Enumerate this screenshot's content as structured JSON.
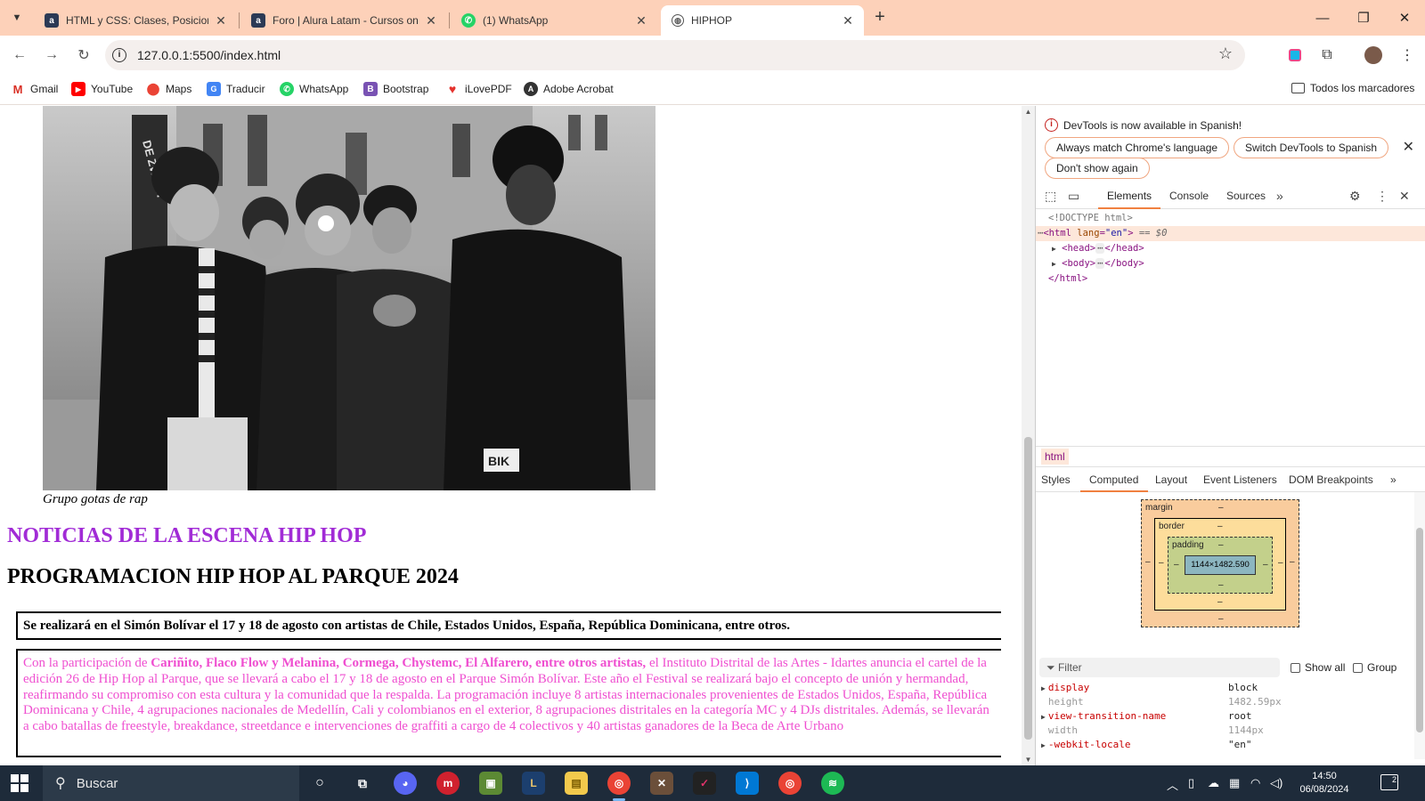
{
  "browser": {
    "tabs": [
      {
        "title": "HTML y CSS: Clases, Posicionamiento",
        "icon": "alura-icon",
        "active": false
      },
      {
        "title": "Foro | Alura Latam - Cursos online",
        "icon": "alura-icon",
        "active": false
      },
      {
        "title": "(1) WhatsApp",
        "icon": "whatsapp-icon",
        "active": false
      },
      {
        "title": "HIPHOP",
        "icon": "globe-icon",
        "active": true
      }
    ],
    "url": "127.0.0.1:5500/index.html",
    "bookmarks": [
      {
        "label": "Gmail",
        "icon": "gmail-icon",
        "color": "#d93025"
      },
      {
        "label": "YouTube",
        "icon": "youtube-icon",
        "color": "#ff0000"
      },
      {
        "label": "Maps",
        "icon": "maps-icon",
        "color": "#34a853"
      },
      {
        "label": "Traducir",
        "icon": "translate-icon",
        "color": "#4285f4"
      },
      {
        "label": "WhatsApp",
        "icon": "whatsapp-icon",
        "color": "#25d366"
      },
      {
        "label": "Bootstrap",
        "icon": "bootstrap-icon",
        "color": "#7952b3"
      },
      {
        "label": "iLovePDF",
        "icon": "ilovepdf-icon",
        "color": "#e5322d"
      },
      {
        "label": "Adobe Acrobat",
        "icon": "acrobat-icon",
        "color": "#333333"
      }
    ],
    "all_bookmarks": "Todos los marcadores"
  },
  "page": {
    "caption": "Grupo gotas de rap",
    "news_title": "NOTICIAS DE LA ESCENA HIP HOP",
    "prog_title": "PROGRAMACION HIP HOP AL PARQUE 2024",
    "summary": "Se realizará en el Simón Bolívar el 17 y 18 de agosto con artistas de Chile, Estados Unidos, España, República Dominicana, entre otros.",
    "article_intro": "Con la participación de ",
    "article_artists": "Cariñito, Flaco Flow y Melanina, Cormega, Chystemc, El Alfarero, entre otros artistas,",
    "article_body": " el Instituto Distrital de las Artes - Idartes anuncia el cartel de la edición 26 de Hip Hop al Parque, que se llevará a cabo el 17 y 18 de agosto en el Parque Simón Bolívar. Este año el Festival se realizará bajo el concepto de unión y hermandad, reafirmando su compromiso con esta cultura y la comunidad que la respalda. La programación incluye 8 artistas internacionales provenientes de Estados Unidos, España, República Dominicana y Chile, 4 agrupaciones nacionales de Medellín, Cali y colombianos en el exterior, 8 agrupaciones distritales en la categoría MC y 4 DJs distritales. Además, se llevarán a cabo batallas de freestyle, breakdance, streetdance e intervenciones de graffiti a cargo de 4 colectivos y 40 artistas ganadores de la Beca de Arte Urbano"
  },
  "devtools": {
    "notice": "DevTools is now available in Spanish!",
    "btn_match": "Always match Chrome's language",
    "btn_switch": "Switch DevTools to Spanish",
    "btn_dont_show": "Don't show again",
    "tabs": [
      "Elements",
      "Console",
      "Sources"
    ],
    "dom": {
      "doctype": "<!DOCTYPE html>",
      "html_open": "<html",
      "html_attr": "lang",
      "html_val": "\"en\"",
      "html_close": ">",
      "sel_marker": "== $0",
      "head": "<head>",
      "head_close": "</head>",
      "body": "<body>",
      "body_close": "</body>",
      "html_end": "</html>"
    },
    "breadcrumb": "html",
    "subtabs": [
      "Styles",
      "Computed",
      "Layout",
      "Event Listeners",
      "DOM Breakpoints"
    ],
    "box_model": {
      "margin": "margin",
      "border": "border",
      "padding": "padding",
      "content": "1144×1482.590",
      "dash": "–"
    },
    "filter_placeholder": "Filter",
    "show_all": "Show all",
    "group": "Group",
    "properties": [
      {
        "name": "display",
        "value": "block",
        "expandable": true
      },
      {
        "name": "height",
        "value": "1482.59px",
        "expandable": false
      },
      {
        "name": "view-transition-name",
        "value": "root",
        "expandable": true
      },
      {
        "name": "width",
        "value": "1144px",
        "expandable": false
      },
      {
        "name": "-webkit-locale",
        "value": "\"en\"",
        "expandable": true
      }
    ]
  },
  "taskbar": {
    "search": "Buscar",
    "time": "14:50",
    "date": "06/08/2024",
    "notifications": "2"
  }
}
